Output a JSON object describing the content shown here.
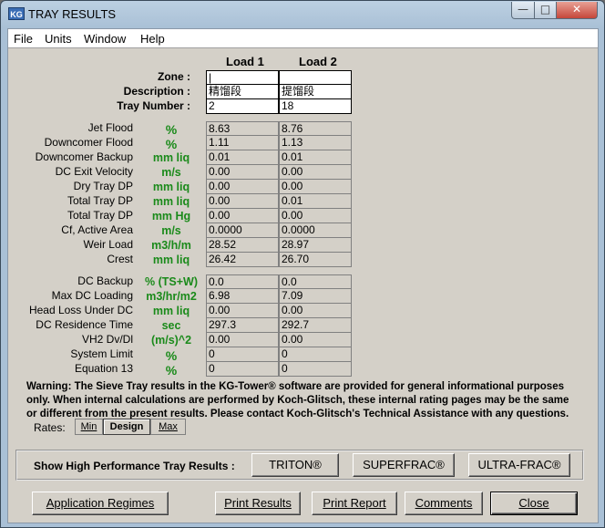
{
  "window": {
    "title": "TRAY RESULTS",
    "icon_text": "KG",
    "min_glyph": "—",
    "max_glyph": "□",
    "close_glyph": "✕"
  },
  "menu": [
    "File",
    "Units",
    "Window",
    "Help"
  ],
  "columns": {
    "load1": "Load 1",
    "load2": "Load 2"
  },
  "inputs": [
    {
      "label": "Zone :",
      "v1": "|",
      "v2": ""
    },
    {
      "label": "Description :",
      "v1": "精馏段",
      "v2": "提馏段"
    },
    {
      "label": "Tray Number :",
      "v1": "2",
      "v2": "18"
    }
  ],
  "group1": [
    {
      "label": "Jet Flood",
      "unit": "%",
      "v1": "8.63",
      "v2": "8.76"
    },
    {
      "label": "Downcomer Flood",
      "unit": "%",
      "v1": "1.11",
      "v2": "1.13"
    },
    {
      "label": "Downcomer Backup",
      "unit": "mm liq",
      "v1": "0.01",
      "v2": "0.01"
    },
    {
      "label": "DC Exit Velocity",
      "unit": "m/s",
      "v1": "0.00",
      "v2": "0.00"
    },
    {
      "label": "Dry Tray DP",
      "unit": "mm liq",
      "v1": "0.00",
      "v2": "0.00"
    },
    {
      "label": "Total Tray DP",
      "unit": "mm liq",
      "v1": "0.00",
      "v2": "0.01"
    },
    {
      "label": "Total Tray DP",
      "unit": "mm Hg",
      "v1": "0.00",
      "v2": "0.00"
    },
    {
      "label": "Cf, Active Area",
      "unit": "m/s",
      "v1": "0.0000",
      "v2": "0.0000"
    },
    {
      "label": "Weir Load",
      "unit": "m3/h/m",
      "v1": "28.52",
      "v2": "28.97"
    },
    {
      "label": "Crest",
      "unit": "mm liq",
      "v1": "26.42",
      "v2": "26.70"
    }
  ],
  "group2": [
    {
      "label": "DC Backup",
      "unit": "% (TS+W)",
      "v1": "0.0",
      "v2": "0.0"
    },
    {
      "label": "Max DC Loading",
      "unit": "m3/hr/m2",
      "v1": "6.98",
      "v2": "7.09"
    },
    {
      "label": "Head Loss Under DC",
      "unit": "mm liq",
      "v1": "0.00",
      "v2": "0.00"
    },
    {
      "label": "DC Residence Time",
      "unit": "sec",
      "v1": "297.3",
      "v2": "292.7"
    },
    {
      "label": "VH2 Dv/Dl",
      "unit": "(m/s)^2",
      "v1": "0.00",
      "v2": "0.00"
    },
    {
      "label": "System Limit",
      "unit": "%",
      "v1": "0",
      "v2": "0"
    },
    {
      "label": "Equation 13",
      "unit": "%",
      "v1": "0",
      "v2": "0"
    }
  ],
  "warning": "Warning: The Sieve Tray results in the KG-Tower® software are provided for general informational purposes only. When internal calculations are performed by Koch-Glitsch, these internal rating pages may be the same or different from the present results. Please contact Koch-Glitsch's Technical Assistance with any questions.",
  "rates": {
    "label": "Rates:",
    "min": "Min",
    "design": "Design",
    "max": "Max"
  },
  "high_perf": {
    "label": "Show High Performance Tray Results :",
    "triton": "TRITON®",
    "superfrac": "SUPERFRAC®",
    "ultrafrac": "ULTRA-FRAC®"
  },
  "buttons": {
    "regimes": "Application Regimes",
    "print_results": "Print Results",
    "print_report": "Print Report",
    "comments": "Comments",
    "close": "Close"
  }
}
